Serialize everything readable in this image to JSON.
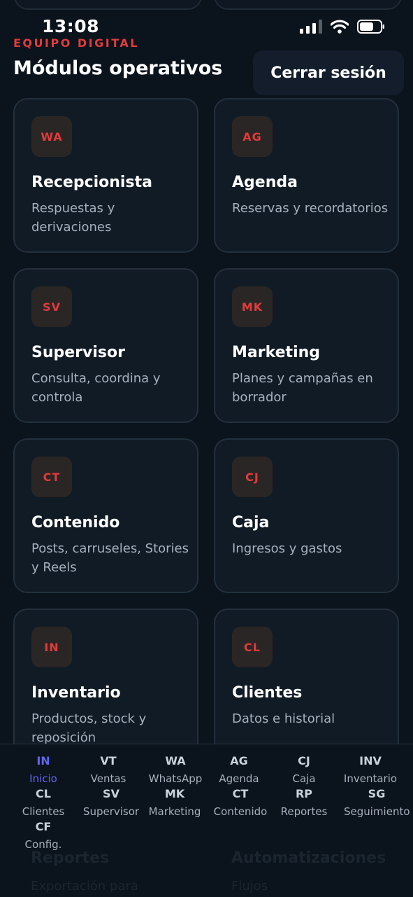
{
  "status": {
    "time": "13:08"
  },
  "header": {
    "brand": "EQUIPO DIGITAL",
    "title": "Módulos operativos",
    "logout_label": "Cerrar sesión"
  },
  "modules": [
    {
      "code": "WA",
      "title": "Recepcionista",
      "description": "Respuestas y derivaciones"
    },
    {
      "code": "AG",
      "title": "Agenda",
      "description": "Reservas y recordatorios"
    },
    {
      "code": "SV",
      "title": "Supervisor",
      "description": "Consulta, coordina y controla"
    },
    {
      "code": "MK",
      "title": "Marketing",
      "description": "Planes y campañas en borrador"
    },
    {
      "code": "CT",
      "title": "Contenido",
      "description": "Posts, carruseles, Stories y Reels"
    },
    {
      "code": "CJ",
      "title": "Caja",
      "description": "Ingresos y gastos"
    },
    {
      "code": "IN",
      "title": "Inventario",
      "description": "Productos, stock y reposición"
    },
    {
      "code": "CL",
      "title": "Clientes",
      "description": "Datos e historial"
    }
  ],
  "hidden_modules": [
    {
      "title": "Reportes",
      "description": "Exportación para"
    },
    {
      "title": "Automatizaciones",
      "description": "Flujos"
    }
  ],
  "tabs": [
    {
      "code": "IN",
      "label": "Inicio",
      "active": true
    },
    {
      "code": "VT",
      "label": "Ventas"
    },
    {
      "code": "WA",
      "label": "WhatsApp"
    },
    {
      "code": "AG",
      "label": "Agenda"
    },
    {
      "code": "CJ",
      "label": "Caja"
    },
    {
      "code": "INV",
      "label": "Inventario"
    },
    {
      "code": "CL",
      "label": "Clientes"
    },
    {
      "code": "SV",
      "label": "Supervisor"
    },
    {
      "code": "MK",
      "label": "Marketing"
    },
    {
      "code": "CT",
      "label": "Contenido"
    },
    {
      "code": "RP",
      "label": "Reportes"
    },
    {
      "code": "SG",
      "label": "Seguimiento"
    },
    {
      "code": "CF",
      "label": "Config."
    }
  ],
  "colors": {
    "accent": "#e23b3b",
    "active_tab": "#6366f1",
    "background": "#0b131c",
    "card": "#111b26"
  }
}
